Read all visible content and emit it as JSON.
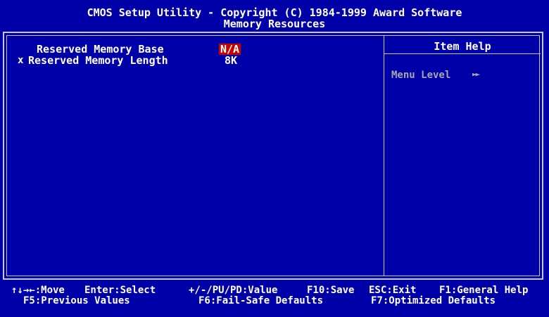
{
  "header": {
    "line1": "CMOS Setup Utility - Copyright (C) 1984-1999 Award Software",
    "line2": "Memory Resources"
  },
  "settings": [
    {
      "marker": "",
      "label": "Reserved Memory Base",
      "value": "N/A",
      "selected": true
    },
    {
      "marker": "x",
      "label": "Reserved Memory Length",
      "value": "8K",
      "selected": false
    }
  ],
  "help_panel": {
    "title": "Item Help",
    "menu_level_label": "Menu Level",
    "menu_level_arrows": "►►"
  },
  "footer": {
    "row1": [
      {
        "text": "↑↓→←:Move"
      },
      {
        "text": "Enter:Select"
      },
      {
        "text": "+/-/PU/PD:Value"
      },
      {
        "text": "F10:Save"
      },
      {
        "text": "ESC:Exit"
      },
      {
        "text": "F1:General Help"
      }
    ],
    "row2": [
      {
        "text": "F5:Previous Values"
      },
      {
        "text": "F6:Fail-Safe Defaults"
      },
      {
        "text": "F7:Optimized Defaults"
      }
    ]
  },
  "colors": {
    "background": "#0000a8",
    "text": "#ffffff",
    "highlight": "#c80000",
    "dim": "#a8a8a8",
    "frame": "#c8c8c8"
  }
}
